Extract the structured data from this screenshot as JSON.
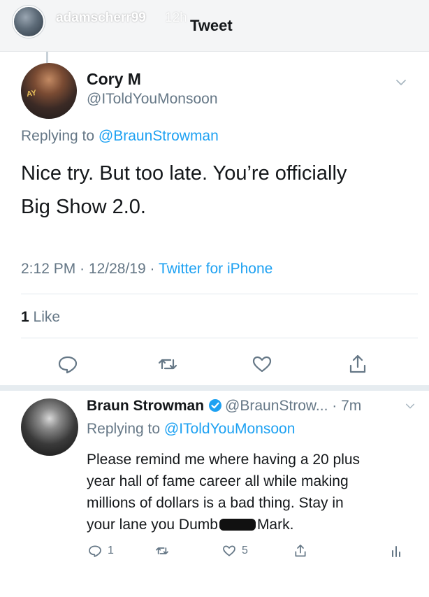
{
  "story": {
    "username": "adamscherr99",
    "time": "12h"
  },
  "page": {
    "title": "Tweet"
  },
  "tweet": {
    "author_name": "Cory M",
    "author_handle": "@IToldYouMonsoon",
    "avatar_text": "AY",
    "replying_prefix": "Replying to ",
    "replying_to": "@BraunStrowman",
    "text_line1": "Nice try. But too late. You’re officially",
    "text_line2": "Big Show 2.0.",
    "time": "2:12 PM",
    "date": "12/28/19",
    "source": "Twitter for iPhone",
    "likes_count": "1",
    "likes_label": "Like"
  },
  "reply": {
    "author_name": "Braun Strowman",
    "author_handle": "@BraunStrow...",
    "age": "7m",
    "replying_prefix": "Replying to ",
    "replying_to": "@IToldYouMonsoon",
    "text_line1": "Please remind me where having a 20 plus",
    "text_line2": "year hall of fame career all while making",
    "text_line3": "millions of dollars is a bad thing.  Stay in",
    "text_line4_a": "your lane you Dumb",
    "text_line4_b": "Mark.",
    "reply_count": "1",
    "like_count": "5"
  },
  "colors": {
    "accent": "#1da1f2",
    "secondary_text": "#657786",
    "primary_text": "#14171a",
    "divider": "#e1e8ed"
  },
  "icons": [
    "chevron-down-icon",
    "reply-icon",
    "retweet-icon",
    "like-icon",
    "share-icon",
    "verified-icon",
    "analytics-icon"
  ]
}
